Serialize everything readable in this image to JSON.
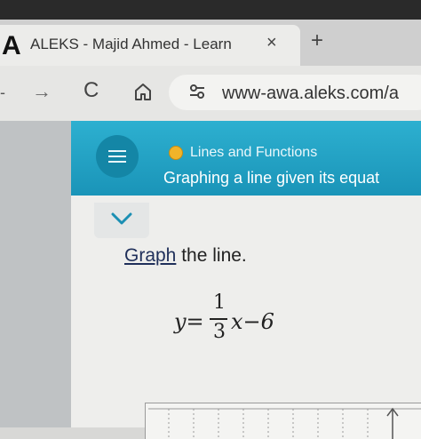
{
  "browser": {
    "tab": {
      "favicon_letter": "A",
      "title": "ALEKS - Majid Ahmed - Learn",
      "close_glyph": "×"
    },
    "new_tab_glyph": "+",
    "nav": {
      "back_glyph": "-",
      "forward_glyph": "→",
      "reload_glyph": "C",
      "home_icon": "home-icon",
      "site_settings_icon": "tune-icon"
    },
    "url": "www-awa.aleks.com/a"
  },
  "aleks": {
    "menu_icon": "hamburger-icon",
    "topic_status_color": "#f0b429",
    "topic": "Lines and Functions",
    "problem_title": "Graphing a line given its equat",
    "collapse_icon": "chevron-down-icon",
    "instruction": {
      "link_text": "Graph",
      "rest_text": " the line."
    },
    "equation": {
      "lhs": "y=",
      "numerator": "1",
      "denominator": "3",
      "rhs": "x−6"
    }
  },
  "colors": {
    "header_teal": "#1b9fc3",
    "accent_dot": "#f0b429"
  }
}
